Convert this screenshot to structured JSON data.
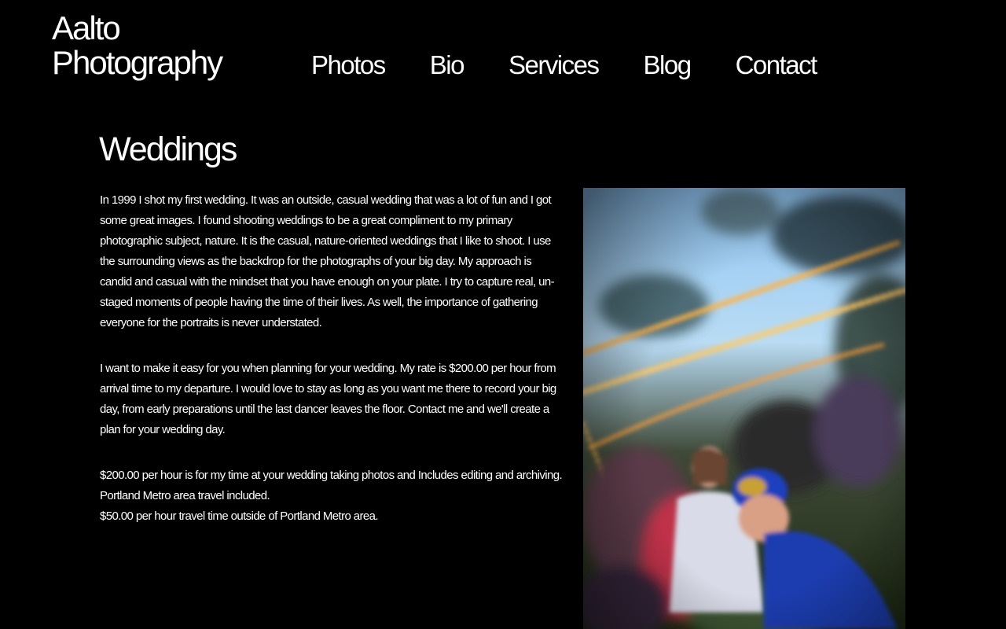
{
  "site": {
    "logo_line1": "Aalto",
    "logo_line2": "Photography"
  },
  "nav": {
    "items": [
      {
        "label": "Photos"
      },
      {
        "label": "Bio"
      },
      {
        "label": "Services"
      },
      {
        "label": "Blog"
      },
      {
        "label": "Contact"
      }
    ]
  },
  "page": {
    "title": "Weddings",
    "paragraphs": [
      "In 1999 I shot my first wedding. It was an outside, casual wedding that was a lot of fun and I got some great images. I found shooting weddings to be a great compliment to my primary photographic subject, nature. It is the casual, nature-oriented weddings that I like to shoot. I use the surrounding views as the backdrop for the photographs of your big day. My approach is candid and casual with the mindset that you have enough on your plate. I try to capture real, un-staged moments of people having the time of their lives. As well, the importance of gathering everyone for the portraits is never understated.",
      "I want to make it easy for you when planning for your wedding. My rate is $200.00 per hour from arrival time to my departure. I would love to stay as long as you want me there to record your big day, from early preparations until the last dancer leaves the floor. Contact me and we'll create a plan for your wedding day."
    ],
    "rate_lines": [
      "$200.00 per hour is for my time at your wedding taking photos and Includes editing and archiving.",
      "Portland Metro area travel included.",
      "$50.00 per hour travel time outside of Portland Metro area."
    ]
  },
  "colors": {
    "background": "#000000",
    "text": "#ffffff"
  }
}
